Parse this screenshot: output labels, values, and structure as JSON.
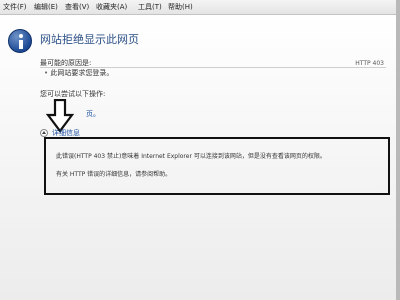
{
  "menu": {
    "items": [
      "文件(F)",
      "编辑(E)",
      "查看(V)",
      "收藏夹(A)",
      "工具(T)",
      "帮助(H)"
    ]
  },
  "error": {
    "title": "网站拒绝显示此网页",
    "code": "HTTP 403",
    "causes_heading": "最可能的原因是:",
    "cause_item": "此网站要求您登录。",
    "try_heading": "您可以尝试以下操作:",
    "try_link_fragment": "页。",
    "details_label": "详细信息",
    "detail_line1": "此错误(HTTP 403 禁止)意味着 Internet Explorer 可以连接到该网站，但是没有查看该网页的权限。",
    "detail_line2": "有关 HTTP 错误的详细信息，请参阅帮助。"
  },
  "colors": {
    "title": "#2a4f86",
    "link": "#1a4fa0",
    "annotation": "#111111"
  },
  "icons": {
    "info": "info-icon",
    "details_toggle": "chevron-up-icon",
    "annotation": "down-arrow-icon"
  }
}
